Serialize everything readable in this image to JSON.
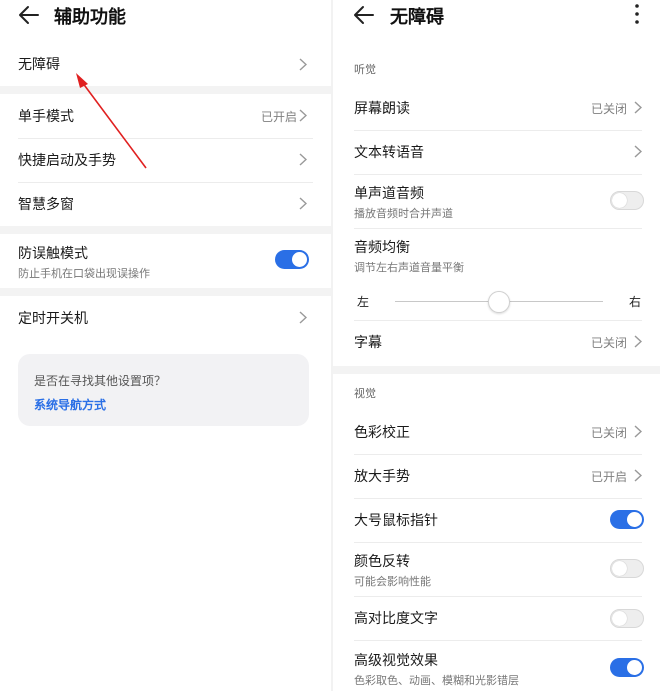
{
  "left": {
    "title": "辅助功能",
    "items": {
      "accessibility": "无障碍",
      "one_hand": {
        "label": "单手模式",
        "value": "已开启"
      },
      "shortcut": "快捷启动及手势",
      "smart_window": "智慧多窗",
      "mistouch": {
        "label": "防误触模式",
        "sub": "防止手机在口袋出现误操作",
        "on": true
      },
      "schedule": "定时开关机"
    },
    "card": {
      "question": "是否在寻找其他设置项？",
      "link": "系统导航方式"
    }
  },
  "right": {
    "title": "无障碍",
    "sections": {
      "hearing": "听觉",
      "vision": "视觉"
    },
    "items": {
      "screen_reader": {
        "label": "屏幕朗读",
        "value": "已关闭"
      },
      "tts": "文本转语音",
      "mono_audio": {
        "label": "单声道音频",
        "sub": "播放音频时合并声道",
        "on": false
      },
      "audio_balance": {
        "label": "音频均衡",
        "sub": "调节左右声道音量平衡",
        "left": "左",
        "right": "右",
        "level": 0.5
      },
      "captions": {
        "label": "字幕",
        "value": "已关闭"
      },
      "color_correction": {
        "label": "色彩校正",
        "value": "已关闭"
      },
      "magnify": {
        "label": "放大手势",
        "value": "已开启"
      },
      "large_pointer": {
        "label": "大号鼠标指针",
        "on": true
      },
      "invert": {
        "label": "颜色反转",
        "sub": "可能会影响性能",
        "on": false
      },
      "high_contrast": {
        "label": "高对比度文字",
        "on": false
      },
      "advanced_visual": {
        "label": "高级视觉效果",
        "sub": "色彩取色、动画、模糊和光影错层",
        "on": true
      }
    }
  },
  "colors": {
    "accent": "#2a6fe6",
    "annotation_arrow": "#e02020"
  }
}
